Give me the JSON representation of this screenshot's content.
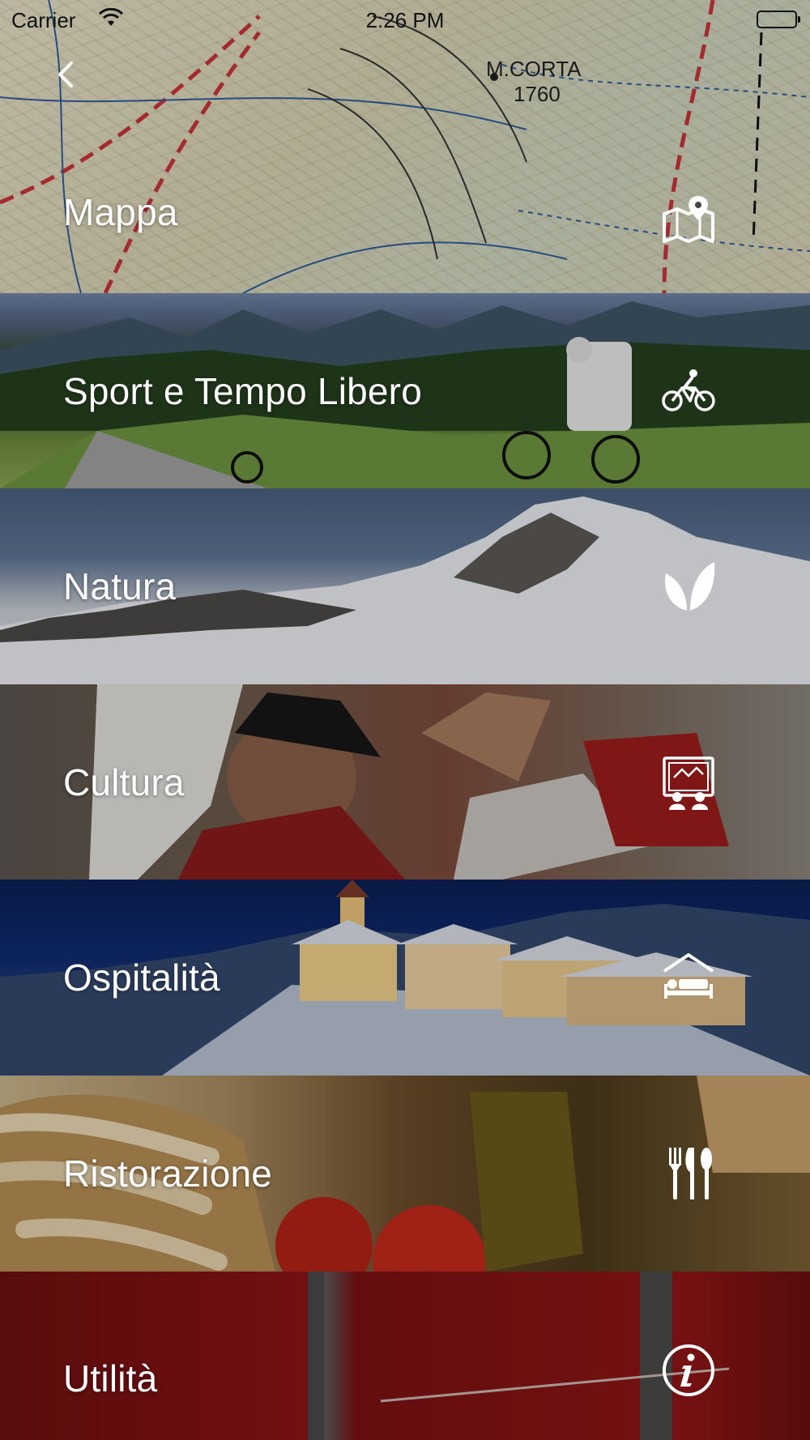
{
  "status_bar": {
    "carrier": "Carrier",
    "time": "2:26 PM"
  },
  "back_icon": "chevron-left-icon",
  "menu": [
    {
      "id": "mappa",
      "label": "Mappa",
      "icon": "map-pin-icon"
    },
    {
      "id": "sport",
      "label": "Sport e Tempo Libero",
      "icon": "bicycle-icon"
    },
    {
      "id": "natura",
      "label": "Natura",
      "icon": "leaf-icon"
    },
    {
      "id": "cultura",
      "label": "Cultura",
      "icon": "theater-icon"
    },
    {
      "id": "ospitalita",
      "label": "Ospitalità",
      "icon": "bed-icon"
    },
    {
      "id": "ristorazione",
      "label": "Ristorazione",
      "icon": "cutlery-icon"
    },
    {
      "id": "utilita",
      "label": "Utilità",
      "icon": "info-icon"
    }
  ],
  "map_labels": {
    "peak": "M.CORTA",
    "peak_height": "1760"
  }
}
